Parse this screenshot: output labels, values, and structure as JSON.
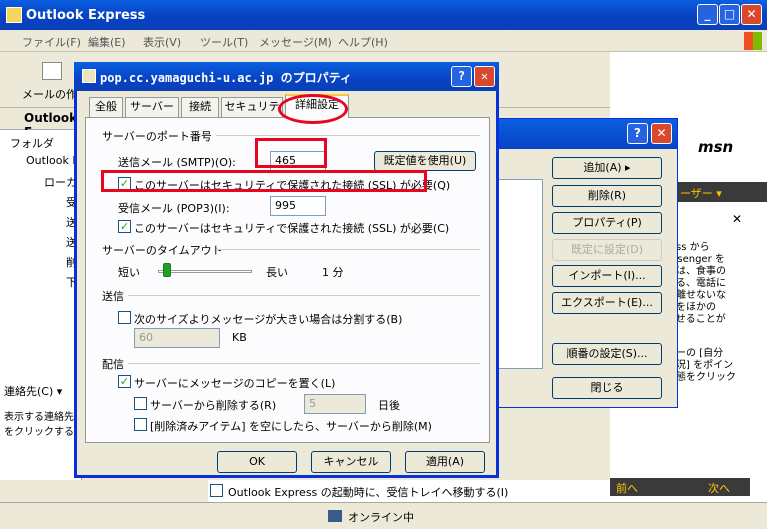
{
  "main_window": {
    "title": "Outlook Express",
    "menu": [
      "ファイル(F)",
      "編集(E)",
      "表示(V)",
      "ツール(T)",
      "メッセージ(M)",
      "ヘルプ(H)"
    ],
    "toolbar_label": "メールの作成",
    "outlook_bar": "Outlook E",
    "folder_header": "フォルダ",
    "tree": [
      "Outlook E",
      "ローカ"
    ],
    "subfolders": [
      "受",
      "送",
      "送",
      "削",
      "下"
    ],
    "contacts_label": "連絡先(C) ▾",
    "contacts_text": "表示する連絡先\nをクリックすると、",
    "status": "オンライン中",
    "msn": "msn",
    "right_pane_lines": [
      "ress から",
      "essenger を",
      "合は、食事の",
      "いる、電話に",
      "が離せないな",
      "態をほかの",
      "らせることが",
      "ューの [自分",
      "状況] をポイン",
      "状態をクリック"
    ],
    "right_header": "ーザー ▾",
    "prev": "前へ",
    "next": "次へ",
    "startup_check": "Outlook Express の起動時に、受信トレイへ移動する(I)"
  },
  "back_dialog": {
    "buttons": [
      "追加(A)",
      "削除(R)",
      "プロパティ(P)",
      "既定に設定(D)",
      "インポート(I)...",
      "エクスポート(E)...",
      "順番の設定(S)...",
      "閉じる"
    ]
  },
  "dialog": {
    "title": "pop.cc.yamaguchi-u.ac.jp のプロパティ",
    "tabs": [
      "全般",
      "サーバー",
      "接続",
      "セキュリティ",
      "詳細設定"
    ],
    "port_section": "サーバーのポート番号",
    "smtp_label": "送信メール (SMTP)(O):",
    "smtp_value": "465",
    "default_button": "既定値を使用(U)",
    "smtp_ssl": "このサーバーはセキュリティで保護された接続 (SSL) が必要(Q)",
    "pop3_label": "受信メール (POP3)(I):",
    "pop3_value": "995",
    "pop3_ssl": "このサーバーはセキュリティで保護された接続 (SSL) が必要(C)",
    "timeout_section": "サーバーのタイムアウト",
    "short": "短い",
    "long": "長い",
    "timeout_value": "1 分",
    "timeout_level": 0.1,
    "send_section": "送信",
    "split_label": "次のサイズよりメッセージが大きい場合は分割する(B)",
    "split_value": "60",
    "kb": "KB",
    "delivery_section": "配信",
    "leave_copy": "サーバーにメッセージのコピーを置く(L)",
    "remove_after": "サーバーから削除する(R)",
    "remove_days": "5",
    "days": "日後",
    "remove_deleted": "[削除済みアイテム] を空にしたら、サーバーから削除(M)",
    "ok": "OK",
    "cancel": "キャンセル",
    "apply": "適用(A)"
  }
}
